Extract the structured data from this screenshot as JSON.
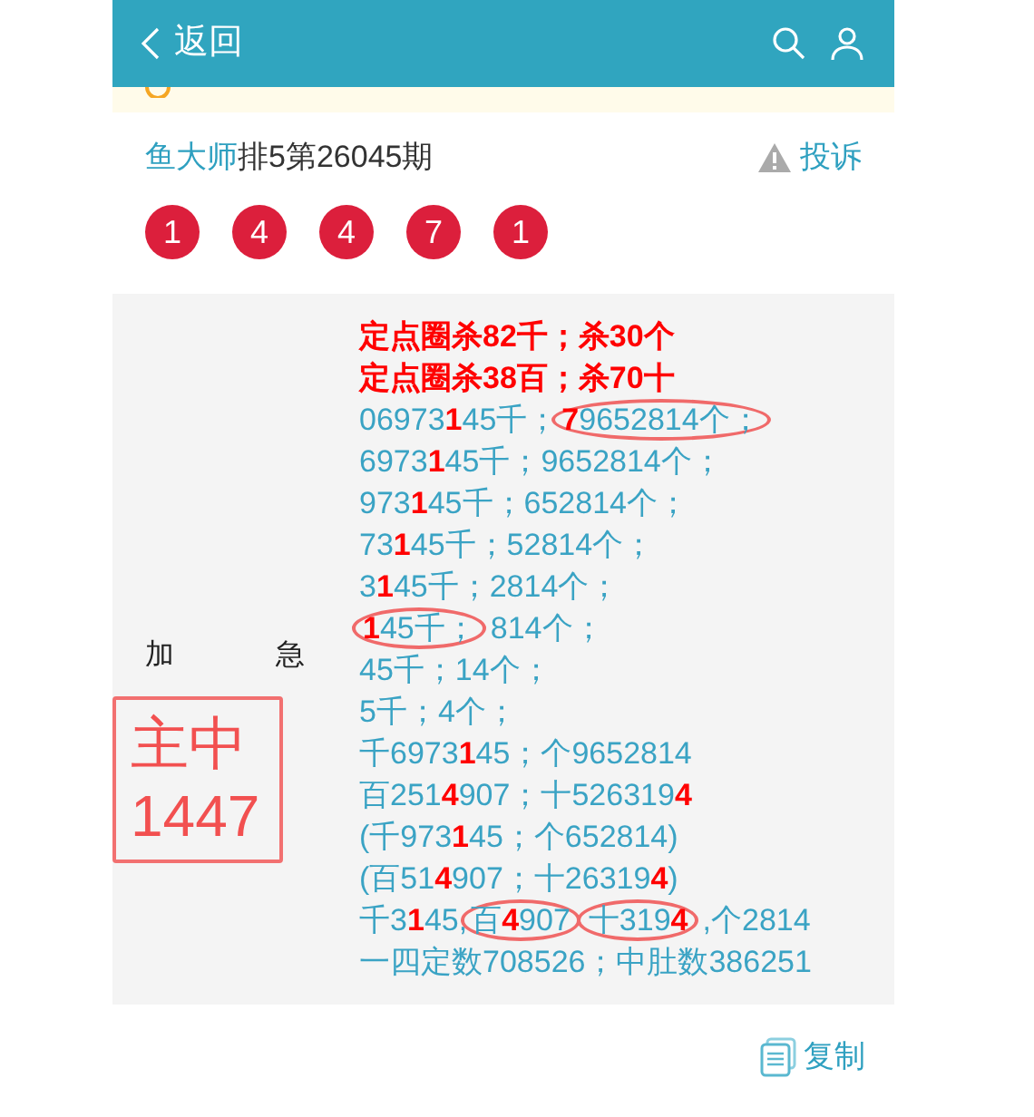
{
  "header": {
    "back_label": "返回"
  },
  "post": {
    "author": "鱼大师",
    "title": "排5第26045期",
    "report_label": "投诉"
  },
  "balls": [
    "1",
    "4",
    "4",
    "7",
    "1"
  ],
  "side": {
    "urgent_chars": [
      "加",
      "急"
    ],
    "hit_lines": [
      "主中",
      "1447"
    ]
  },
  "lines": [
    {
      "kind": "headline",
      "segments": [
        {
          "text": "定点圈杀82千；杀30个",
          "circled": false
        }
      ]
    },
    {
      "kind": "headline",
      "segments": [
        {
          "text": "定点圈杀38百；杀70十",
          "circled": false
        }
      ]
    },
    {
      "kind": "plain",
      "segments": [
        {
          "text": "06973**1**45千；",
          "circled": false
        },
        {
          "text": "**7**9652814个；",
          "circled": true
        }
      ]
    },
    {
      "kind": "plain",
      "segments": [
        {
          "text": "6973**1**45千；9652814个；",
          "circled": false
        }
      ]
    },
    {
      "kind": "plain",
      "segments": [
        {
          "text": "973**1**45千；652814个；",
          "circled": false
        }
      ]
    },
    {
      "kind": "plain",
      "segments": [
        {
          "text": "73**1**45千；52814个；",
          "circled": false
        }
      ]
    },
    {
      "kind": "plain",
      "segments": [
        {
          "text": "3**1**45千；2814个；",
          "circled": false
        }
      ]
    },
    {
      "kind": "plain",
      "segments": [
        {
          "text": "**1**45千；",
          "circled": true
        },
        {
          "text": "814个；",
          "circled": false
        }
      ]
    },
    {
      "kind": "plain",
      "segments": [
        {
          "text": "45千；14个；",
          "circled": false
        }
      ]
    },
    {
      "kind": "plain",
      "segments": [
        {
          "text": "5千；4个；",
          "circled": false
        }
      ]
    },
    {
      "kind": "plain",
      "segments": [
        {
          "text": "千6973**1**45；个9652814",
          "circled": false
        }
      ]
    },
    {
      "kind": "plain",
      "segments": [
        {
          "text": "百251**4**907；十526319**4**",
          "circled": false
        }
      ]
    },
    {
      "kind": "plain",
      "segments": [
        {
          "text": "(千973**1**45；个652814)",
          "circled": false
        }
      ]
    },
    {
      "kind": "plain",
      "segments": [
        {
          "text": "(百51**4**907；十26319**4**)",
          "circled": false
        }
      ]
    },
    {
      "kind": "plain",
      "segments": [
        {
          "text": "千3**1**45,",
          "circled": false
        },
        {
          "text": "百**4**907",
          "circled": true
        },
        {
          "text": "十319**4**",
          "circled": true
        },
        {
          "text": ",个2814",
          "circled": false
        }
      ]
    },
    {
      "kind": "plain",
      "segments": [
        {
          "text": "一四定数708526；中肚数386251",
          "circled": false
        }
      ]
    }
  ],
  "copy_label": "复制"
}
